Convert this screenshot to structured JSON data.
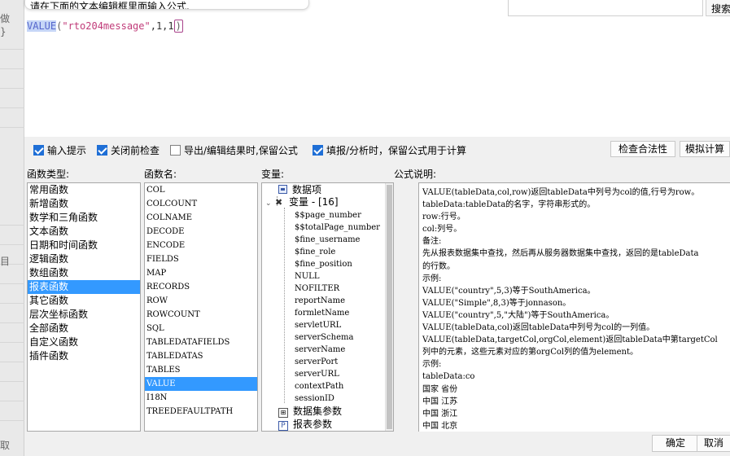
{
  "background": {
    "fragments": [
      "做",
      "}",
      "目",
      "取"
    ]
  },
  "editor": {
    "tip": "请在下面的文本编辑框里面输入公式.",
    "search_placeholder": "",
    "search_button": "搜索",
    "formula": {
      "fn": "VALUE",
      "open": "(",
      "arg1": "\"rto204message\"",
      "rest": ",1,1",
      "close": ")"
    }
  },
  "options": {
    "input_hint": {
      "label": "输入提示",
      "checked": true
    },
    "check_before_close": {
      "label": "关闭前检查",
      "checked": true
    },
    "export_keep": {
      "label": "导出/编辑结果时,保留公式",
      "checked": false
    },
    "fill_keep": {
      "label": "填报/分析时，保留公式用于计算",
      "checked": true
    },
    "check_validity": "检查合法性",
    "simulate": "模拟计算"
  },
  "labels": {
    "fn_type": "函数类型:",
    "fn_name": "函数名:",
    "vars": "变量:",
    "desc": "公式说明:"
  },
  "fn_types": [
    "常用函数",
    "新增函数",
    "数学和三角函数",
    "文本函数",
    "日期和时间函数",
    "逻辑函数",
    "数组函数",
    "报表函数",
    "其它函数",
    "层次坐标函数",
    "全部函数",
    "自定义函数",
    "插件函数"
  ],
  "fn_types_selected": "报表函数",
  "fn_names": [
    "COL",
    "COLCOUNT",
    "COLNAME",
    "DECODE",
    "ENCODE",
    "FIELDS",
    "MAP",
    "RECORDS",
    "ROW",
    "ROWCOUNT",
    "SQL",
    "TABLEDATAFIELDS",
    "TABLEDATAS",
    "TABLES",
    "VALUE",
    "I18N",
    "TREEDEFAULTPATH"
  ],
  "fn_names_selected": "VALUE",
  "variables": {
    "data_items": "数据项",
    "var_group": "变量 - [16]",
    "vars": [
      "$$page_number",
      "$$totalPage_number",
      "$fine_username",
      "$fine_role",
      "$fine_position",
      "NULL",
      "NOFILTER",
      "reportName",
      "formletName",
      "servletURL",
      "serverSchema",
      "serverName",
      "serverPort",
      "serverURL",
      "contextPath",
      "sessionID"
    ],
    "dataset_params": "数据集参数",
    "report_params": "报表参数"
  },
  "description": [
    "VALUE(tableData,col,row)返回tableData中列号为col的值,行号为row。",
    "tableData:tableData的名字，字符串形式的。",
    "row:行号。",
    "col:列号。",
    "备注:",
    "先从报表数据集中查找，然后再从服务器数据集中查找，返回的是tableData",
    "的行数。",
    "示例:",
    "VALUE(\"country\",5,3)等于SouthAmerica。",
    "VALUE(\"Simple\",8,3)等于jonnason。",
    "VALUE(\"country\",5,\"大陆\")等于SouthAmerica。",
    "VALUE(tableData,col)返回tableData中列号为col的一列值。",
    "VALUE(tableData,targetCol,orgCol,element)返回tableData中第targetCol",
    "列中的元素，这些元素对应的第orgCol列的值为element。",
    "示例:",
    "tableData:co",
    "国家  省份",
    "中国  江苏",
    "中国  浙江",
    "中国  北京"
  ],
  "footer": {
    "ok": "确定",
    "cancel": "取消"
  }
}
